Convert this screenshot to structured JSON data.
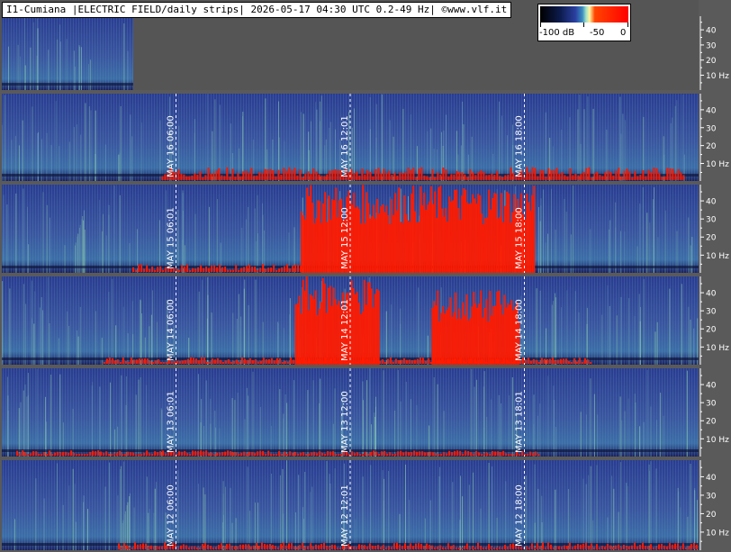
{
  "title": "I1-Cumiana |ELECTRIC FIELD/daily strips| 2026-05-17 04:30 UTC 0.2-49 Hz| ©www.vlf.it",
  "legend": {
    "labels": [
      "-100 dB",
      "-50",
      "0"
    ]
  },
  "colors": {
    "background": "#5a5a5a",
    "header": "#555555",
    "spectrogram_low": "#1a2a80",
    "spectrogram_mid": "#6fa0b0",
    "spectrogram_high": "#ff0000"
  },
  "chart_data": {
    "type": "heatmap",
    "yunit": "Hz",
    "yrange": [
      0.2,
      49
    ],
    "yticks": [
      10,
      20,
      30,
      40
    ],
    "ytick_labels": [
      "40",
      "30",
      "20",
      "10 Hz"
    ],
    "strips": [
      {
        "date": "2026-05-17",
        "partial": true,
        "marker_labels": [],
        "red_bursts": []
      },
      {
        "date": "2026-05-16",
        "marker_labels": [
          "MAY 16 06:00",
          "MAY 16 12:01",
          "MAY 16 18:00"
        ],
        "red_bursts": [
          [
            5.5,
            23.5,
            0.1
          ]
        ]
      },
      {
        "date": "2026-05-15",
        "marker_labels": [
          "MAY 15 06:01",
          "MAY 15 12:00",
          "MAY 15 18:00"
        ],
        "red_bursts": [
          [
            10.3,
            18.3,
            1.0
          ],
          [
            4.5,
            10.3,
            0.06
          ]
        ]
      },
      {
        "date": "2026-05-14",
        "marker_labels": [
          "MAY 14 06:00",
          "MAY 14 12:01",
          "MAY 14 18:00"
        ],
        "red_bursts": [
          [
            10.1,
            13.0,
            1.0
          ],
          [
            14.8,
            17.8,
            0.85
          ],
          [
            3.5,
            20.3,
            0.05
          ]
        ]
      },
      {
        "date": "2026-05-13",
        "marker_labels": [
          "MAY 13 06:01",
          "MAY 13 12:00",
          "MAY 13 18:01"
        ],
        "red_bursts": [
          [
            0.5,
            18.5,
            0.04
          ]
        ]
      },
      {
        "date": "2026-05-12",
        "marker_labels": [
          "MAY 12 06:00",
          "MAY 12 12:01",
          "MAY 12 18:00"
        ],
        "red_bursts": [
          [
            4.0,
            24.0,
            0.05
          ]
        ]
      }
    ],
    "marker_hours": [
      6,
      12,
      18
    ],
    "x_range_hours": [
      0,
      24
    ]
  }
}
